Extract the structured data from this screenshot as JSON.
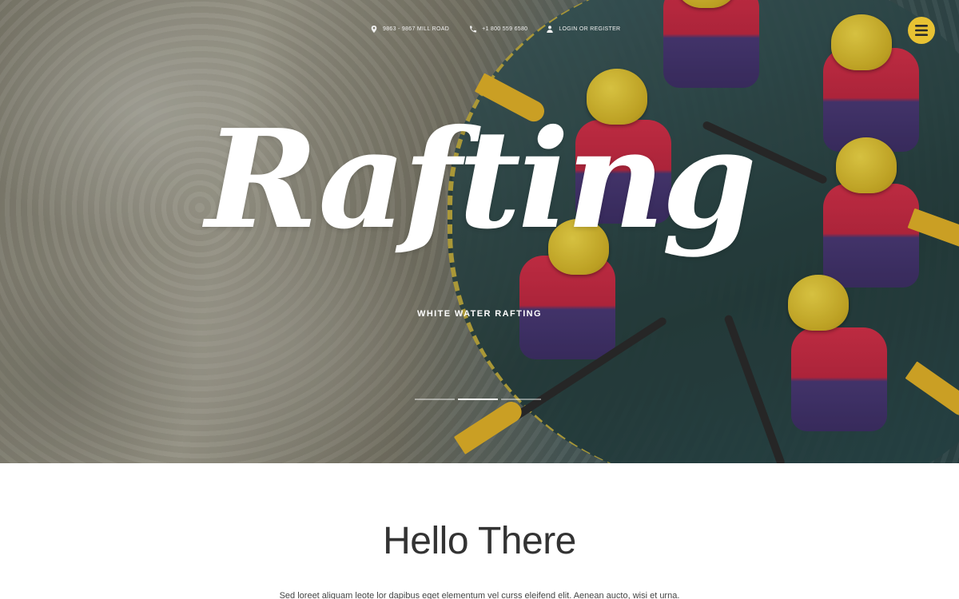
{
  "topbar": {
    "address": "9863 - 9867 Mill Road",
    "phone": "+1 800 559 6580",
    "login": "Login or register"
  },
  "hero": {
    "title": "Rafting",
    "subtitle": "WHITE WATER RAFTING",
    "slides_total": 3,
    "active_slide": 2
  },
  "content": {
    "title": "Hello There",
    "text": "Sed loreet aliquam leote lor dapibus eget elementum vel curss eleifend elit. Aenean aucto, wisi et urna."
  },
  "icons": {
    "address": "map-pin-icon",
    "phone": "phone-icon",
    "login": "user-icon",
    "menu": "hamburger-menu-icon"
  },
  "colors": {
    "accent": "#e8c233",
    "text_dark": "#333333"
  }
}
